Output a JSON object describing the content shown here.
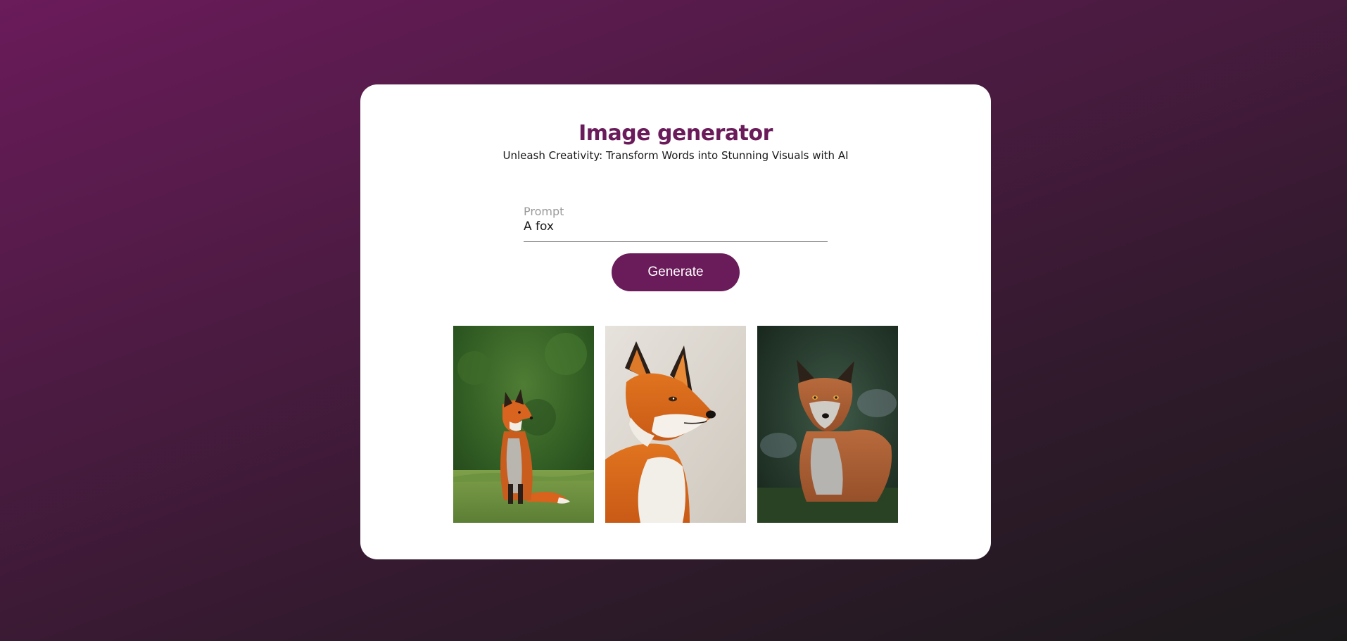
{
  "header": {
    "title": "Image generator",
    "subtitle": "Unleash Creativity: Transform Words into Stunning Visuals with AI"
  },
  "prompt_field": {
    "label": "Prompt",
    "value": "A fox"
  },
  "actions": {
    "generate_label": "Generate"
  },
  "gallery": {
    "images": [
      {
        "subject": "red fox sitting on grass, green background"
      },
      {
        "subject": "red fox head close-up, light background"
      },
      {
        "subject": "grey-orange fox looking forward, dark green background"
      }
    ]
  },
  "colors": {
    "accent": "#6a1b5a",
    "background_start": "#6a1b5a",
    "background_end": "#1b1a1b",
    "card": "#ffffff"
  }
}
